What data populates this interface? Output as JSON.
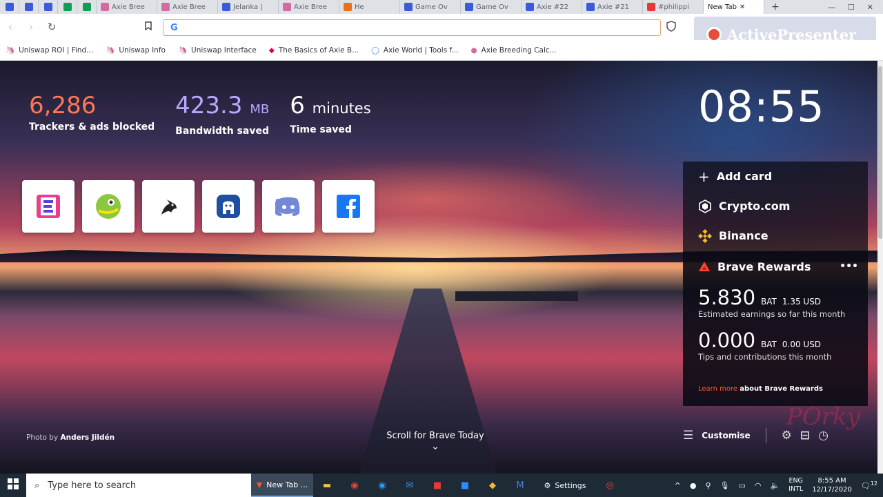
{
  "browser": {
    "tabs": [
      {
        "label": "",
        "pinned": true,
        "color": "#3b5bdb"
      },
      {
        "label": "",
        "pinned": true,
        "color": "#3b5bdb"
      },
      {
        "label": "",
        "pinned": true,
        "color": "#3b5bdb"
      },
      {
        "label": "",
        "pinned": true,
        "color": "#0f9d58"
      },
      {
        "label": "",
        "pinned": true,
        "color": "#0f9d58"
      },
      {
        "label": "Axie Bree",
        "color": "#d46aa0"
      },
      {
        "label": "Axie Bree",
        "color": "#d46aa0"
      },
      {
        "label": "Jelanka |",
        "color": "#3b5bdb"
      },
      {
        "label": "Axie Bree",
        "color": "#d46aa0"
      },
      {
        "label": "He",
        "color": "#e8711a"
      },
      {
        "label": "Game Ov",
        "color": "#3b5bdb"
      },
      {
        "label": "Game Ov",
        "color": "#3b5bdb"
      },
      {
        "label": "Axie #22",
        "color": "#3b5bdb"
      },
      {
        "label": "Axie #21",
        "color": "#3b5bdb"
      },
      {
        "label": "#philippi",
        "color": "#e53935"
      },
      {
        "label": "New Tab",
        "active": true,
        "color": "#fb542b"
      }
    ],
    "url": "",
    "bookmarks": [
      {
        "label": "Uniswap ROI | Find..."
      },
      {
        "label": "Uniswap Info"
      },
      {
        "label": "Uniswap Interface"
      },
      {
        "label": "The Basics of Axie B..."
      },
      {
        "label": "Axie World | Tools f..."
      },
      {
        "label": "Axie Breeding Calc..."
      }
    ],
    "watermark": "ActivePresenter"
  },
  "ntp": {
    "stats": [
      {
        "value": "6,286",
        "unit": "",
        "label": "Trackers & ads blocked",
        "color": "#ff7654"
      },
      {
        "value": "423.3",
        "unit": "MB",
        "label": "Bandwidth saved",
        "color": "#b8a9ff"
      },
      {
        "value": "6",
        "unit": "minutes",
        "label": "Time saved",
        "color": "#ffffff"
      }
    ],
    "clock": "08:55",
    "widget": {
      "add_card": "Add card",
      "crypto": "Crypto.com",
      "binance": "Binance",
      "rewards_title": "Brave Rewards",
      "more": "•••",
      "earnings_value": "5.830",
      "earnings_unit": "BAT",
      "earnings_usd": "1.35 USD",
      "earnings_desc": "Estimated earnings so far this month",
      "tips_value": "0.000",
      "tips_unit": "BAT",
      "tips_usd": "0.00 USD",
      "tips_desc": "Tips and contributions this month",
      "learn_more": "Learn more",
      "learn_suffix": "about Brave Rewards"
    },
    "photo_credit_prefix": "Photo by",
    "photo_credit_name": "Anders Jildén",
    "scroll_cta": "Scroll for Brave Today",
    "customise": "Customise",
    "overlay_text": "POrky"
  },
  "taskbar": {
    "search_placeholder": "Type here to search",
    "active_app": "New Tab ...",
    "settings": "Settings",
    "lang_top": "ENG",
    "lang_bottom": "INTL",
    "time": "8:55 AM",
    "date": "12/17/2020",
    "notif_count": "12"
  }
}
